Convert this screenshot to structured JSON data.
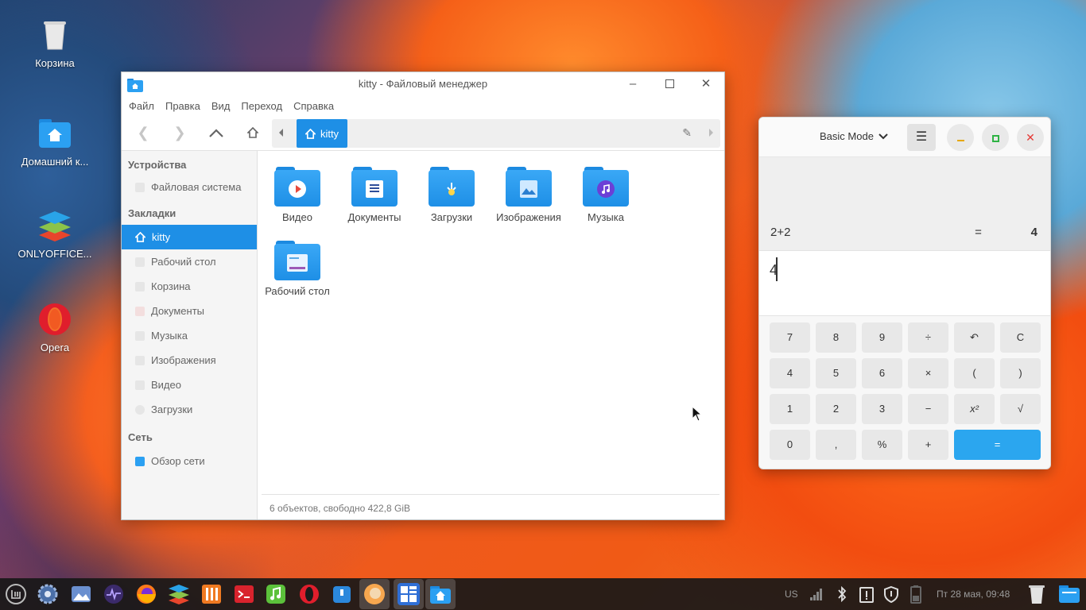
{
  "desktop": {
    "icons": [
      {
        "label": "Корзина",
        "icon": "trash-icon"
      },
      {
        "label": "Домашний к...",
        "icon": "home-folder-icon"
      },
      {
        "label": "ONLYOFFICE...",
        "icon": "onlyoffice-icon"
      },
      {
        "label": "Opera",
        "icon": "opera-icon"
      }
    ]
  },
  "file_manager": {
    "title": "kitty - Файловый менеджер",
    "menu": [
      "Файл",
      "Правка",
      "Вид",
      "Переход",
      "Справка"
    ],
    "breadcrumb": "kitty",
    "sidebar": {
      "sections": [
        {
          "heading": "Устройства",
          "items": [
            "Файловая система"
          ]
        },
        {
          "heading": "Закладки",
          "items": [
            "kitty",
            "Рабочий стол",
            "Корзина",
            "Документы",
            "Музыка",
            "Изображения",
            "Видео",
            "Загрузки"
          ]
        },
        {
          "heading": "Сеть",
          "items": [
            "Обзор сети"
          ]
        }
      ],
      "active_item": "kitty"
    },
    "files": [
      "Видео",
      "Документы",
      "Загрузки",
      "Изображения",
      "Музыка",
      "Рабочий стол"
    ],
    "status": "6  объектов,  свободно 422,8 GiB"
  },
  "calculator": {
    "mode": "Basic Mode",
    "history": {
      "expression": "2+2",
      "equals": "=",
      "result": "4"
    },
    "input": "4",
    "keys": [
      [
        "7",
        "8",
        "9",
        "÷",
        "↶",
        "C"
      ],
      [
        "4",
        "5",
        "6",
        "×",
        "(",
        ")"
      ],
      [
        "1",
        "2",
        "3",
        "−",
        "x²",
        "√"
      ],
      [
        "0",
        ",",
        "%",
        "+",
        "="
      ]
    ],
    "colors": {
      "accent": "#2ba6ef",
      "minimize": "#e6a700",
      "maximize": "#2fb344",
      "close": "#e53935"
    }
  },
  "taskbar": {
    "tray": {
      "keyboard_layout": "US",
      "datetime": "Пт 28 мая, 09:48"
    }
  }
}
